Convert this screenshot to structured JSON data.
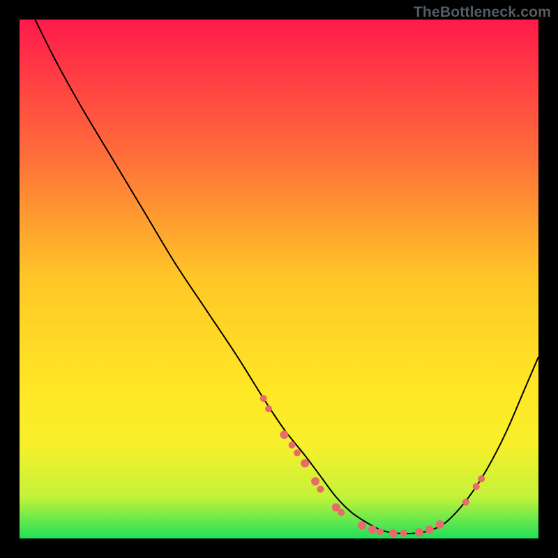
{
  "watermark": "TheBottleneck.com",
  "chart_data": {
    "type": "line",
    "title": "",
    "xlabel": "",
    "ylabel": "",
    "xlim": [
      0,
      100
    ],
    "ylim": [
      0,
      100
    ],
    "grid": false,
    "legend": false,
    "gradient_background": {
      "stops": [
        {
          "offset": 0.0,
          "color": "#ff1a4b"
        },
        {
          "offset": 0.25,
          "color": "#ff6a3b"
        },
        {
          "offset": 0.5,
          "color": "#ffc727"
        },
        {
          "offset": 0.72,
          "color": "#ffe825"
        },
        {
          "offset": 0.82,
          "color": "#f7f02a"
        },
        {
          "offset": 0.92,
          "color": "#c3f23a"
        },
        {
          "offset": 1.0,
          "color": "#1fe05a"
        }
      ]
    },
    "series": [
      {
        "name": "bottleneck-curve",
        "color": "#000000",
        "x": [
          3,
          7,
          12,
          18,
          24,
          30,
          36,
          42,
          47,
          51,
          55,
          58,
          61,
          64,
          67,
          70,
          73,
          76,
          79,
          82,
          85,
          88,
          91,
          94,
          97,
          100
        ],
        "y": [
          100,
          92,
          83,
          73,
          63,
          53,
          44,
          35,
          27,
          21,
          16,
          12,
          8,
          5,
          3,
          1.5,
          1,
          1,
          1.5,
          3,
          6,
          10,
          15,
          21,
          28,
          35
        ]
      }
    ],
    "marker_points": {
      "name": "highlighted-points",
      "color": "#e86a6a",
      "points": [
        {
          "x": 47,
          "y": 27,
          "r": 5
        },
        {
          "x": 48,
          "y": 25,
          "r": 5
        },
        {
          "x": 51,
          "y": 20,
          "r": 6
        },
        {
          "x": 52.5,
          "y": 18,
          "r": 5
        },
        {
          "x": 53.5,
          "y": 16.5,
          "r": 5
        },
        {
          "x": 55,
          "y": 14.5,
          "r": 6
        },
        {
          "x": 57,
          "y": 11,
          "r": 6
        },
        {
          "x": 58,
          "y": 9.5,
          "r": 5
        },
        {
          "x": 61,
          "y": 6,
          "r": 6
        },
        {
          "x": 62,
          "y": 5,
          "r": 5
        },
        {
          "x": 66,
          "y": 2.5,
          "r": 6
        },
        {
          "x": 68,
          "y": 1.7,
          "r": 6
        },
        {
          "x": 69.5,
          "y": 1.3,
          "r": 5
        },
        {
          "x": 72,
          "y": 1.0,
          "r": 6
        },
        {
          "x": 74,
          "y": 1.0,
          "r": 5
        },
        {
          "x": 77,
          "y": 1.2,
          "r": 6
        },
        {
          "x": 79,
          "y": 1.7,
          "r": 6
        },
        {
          "x": 81,
          "y": 2.7,
          "r": 6
        },
        {
          "x": 86,
          "y": 7,
          "r": 5
        },
        {
          "x": 88,
          "y": 10,
          "r": 5
        },
        {
          "x": 89,
          "y": 11.5,
          "r": 5
        }
      ]
    }
  }
}
